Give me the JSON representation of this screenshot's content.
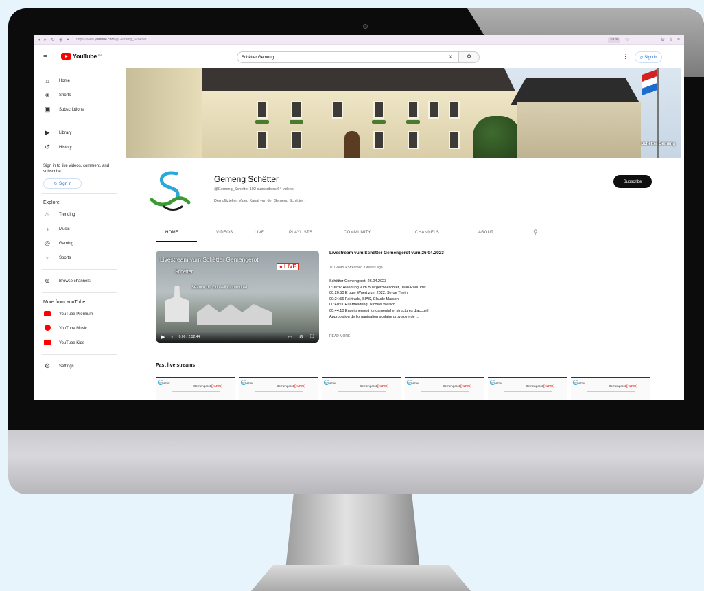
{
  "browser": {
    "url_prefix": "https://www.",
    "url_host": "youtube.com",
    "url_path": "/@Gemeng_Schëtter",
    "zoom": "100%"
  },
  "header": {
    "logo_text": "YouTube",
    "logo_region": "LU",
    "search_value": "Schëtter Gemeng",
    "sign_in_label": "Sign in"
  },
  "sidebar": {
    "main": [
      {
        "label": "Home",
        "icon": "home-icon"
      },
      {
        "label": "Shorts",
        "icon": "shorts-icon"
      },
      {
        "label": "Subscriptions",
        "icon": "subscriptions-icon"
      }
    ],
    "library": [
      {
        "label": "Library",
        "icon": "library-icon"
      },
      {
        "label": "History",
        "icon": "history-icon"
      }
    ],
    "sign_in_prompt": "Sign in to like videos, comment, and subscribe.",
    "sign_in_label": "Sign in",
    "explore_heading": "Explore",
    "explore": [
      {
        "label": "Trending",
        "icon": "trending-icon"
      },
      {
        "label": "Music",
        "icon": "music-icon"
      },
      {
        "label": "Gaming",
        "icon": "gaming-icon"
      },
      {
        "label": "Sports",
        "icon": "sports-icon"
      }
    ],
    "browse_channels": "Browse channels",
    "more_heading": "More from YouTube",
    "more": [
      {
        "label": "YouTube Premium",
        "icon": "youtube-premium-icon"
      },
      {
        "label": "YouTube Music",
        "icon": "youtube-music-icon"
      },
      {
        "label": "YouTube Kids",
        "icon": "youtube-kids-icon"
      }
    ],
    "settings_label": "Settings"
  },
  "banner": {
    "caption": "Schëtter Gemeng"
  },
  "channel": {
    "name": "Gemeng Schëtter",
    "meta": "@Gemeng_Schetter  102 subscribers  64 videos",
    "description": "Den offiziellen Video Kanal vun der Gemeng Schëtter  ›",
    "subscribe_label": "Subscribe"
  },
  "tabs": [
    "HOME",
    "VIDEOS",
    "LIVE",
    "PLAYLISTS",
    "COMMUNITY",
    "CHANNELS",
    "ABOUT"
  ],
  "featured": {
    "thumb_title": "Livestream vum Schëtter Gemengerot",
    "thumb_badge": "● LIVE",
    "thumb_logo_label": "Schëtter",
    "thumb_subtitle": "Séance du Conseil Communal",
    "thumb_time": "0:00 / 2:52:44",
    "title": "Livestream vum Schëtter Gemengerot vum 26.04.2023",
    "meta": "110 views • Streamed 3 weeks ago",
    "description_lines": [
      "Schëtter Gemengerot, 26.04.2023",
      "0:00:37 Aleedung vum Buergermeeschter, Jean-Paul Jost",
      "00:20:50 E puer Wuert zum 2022, Serge Thein",
      "00:24:56 Fairtrade, SIAS, Claude Marson",
      "00:40:11 Ruarmeldung, Nicolas Welsch",
      "00:44:10 Enseignement fondamental et structures d'accueil",
      "Approbation de l'organisation scolaire provisoire de ..."
    ],
    "read_more": "READ MORE"
  },
  "past_streams": {
    "heading": "Past live streams",
    "cards": [
      {
        "logo": "Schëtter",
        "title_prefix": "Gemengerot ",
        "badge": "[+LIVE]"
      },
      {
        "logo": "Schëtter",
        "title_prefix": "Gemengerot ",
        "badge": "[+LIVE]"
      },
      {
        "logo": "Schëtter",
        "title_prefix": "Gemengerot ",
        "badge": "[+LIVE]"
      },
      {
        "logo": "Schëtter",
        "title_prefix": "Gemengerot ",
        "badge": "[+LIVE]"
      },
      {
        "logo": "Schëtter",
        "title_prefix": "Gemengerot ",
        "badge": "[+LIVE]"
      },
      {
        "logo": "Schëtter",
        "title_prefix": "Gemengerot ",
        "badge": "[+LIVE]"
      }
    ]
  },
  "colors": {
    "brand_red": "#ff0000",
    "link_blue": "#065fd4",
    "logo_blue": "#2ca7dc",
    "logo_green": "#3c9a36",
    "background": "#e8f4fb"
  }
}
